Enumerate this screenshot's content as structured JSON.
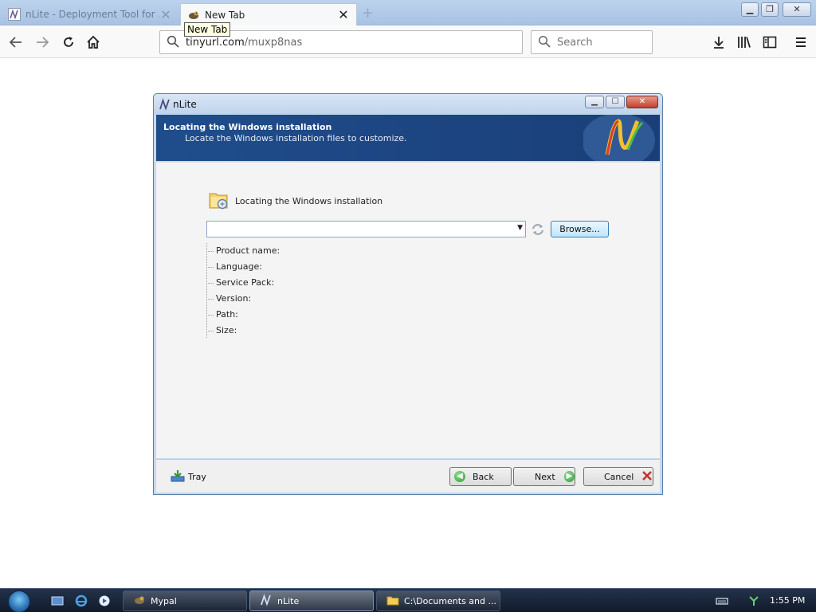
{
  "browser": {
    "tabs": [
      {
        "label": "nLite - Deployment Tool for ...",
        "active": false
      },
      {
        "label": "New Tab",
        "active": true
      }
    ],
    "tooltip": "New Tab",
    "url_host": "tinyurl.com",
    "url_path": "/muxp8nas",
    "search_placeholder": "Search",
    "window_controls": {
      "minimize": "▁",
      "restore": "❐",
      "close": "✕"
    }
  },
  "nlite": {
    "title": "nLite",
    "header_title": "Locating the Windows installation",
    "header_subtitle": "Locate the Windows installation files to customize.",
    "section_label": "Locating the Windows installation",
    "select_value": "",
    "browse_label": "Browse...",
    "info_labels": [
      "Product name:",
      "Language:",
      "Service Pack:",
      "Version:",
      "Path:",
      "Size:"
    ],
    "tray_label": "Tray",
    "back_label": "Back",
    "next_label": "Next",
    "cancel_label": "Cancel",
    "colors": {
      "header_bg": "#1f4d8c",
      "accent_green": "#2e9b32",
      "cancel_x": "#c0302c"
    }
  },
  "taskbar": {
    "items": [
      {
        "label": "Mypal",
        "active": false
      },
      {
        "label": "nLite",
        "active": true
      },
      {
        "label": "C:\\Documents and ...",
        "active": false
      }
    ],
    "clock": "1:55 PM"
  }
}
